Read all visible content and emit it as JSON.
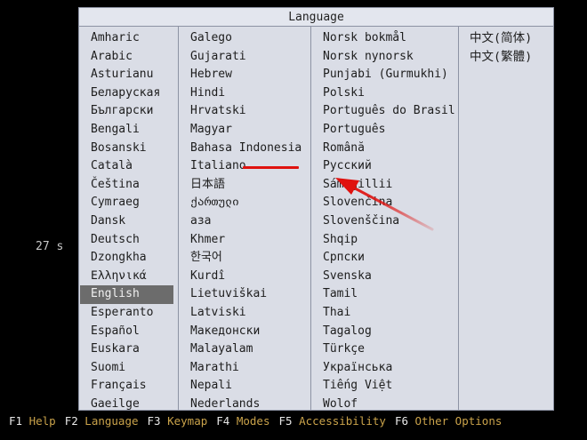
{
  "dialog": {
    "title": "Language",
    "columns": [
      [
        "Amharic",
        "Arabic",
        "Asturianu",
        "Беларуская",
        "Български",
        "Bengali",
        "Bosanski",
        "Català",
        "Čeština",
        "Cymraeg",
        "Dansk",
        "Deutsch",
        "Dzongkha",
        "Ελληνικά",
        "English",
        "Esperanto",
        "Español",
        "Euskara",
        "Suomi",
        "Français",
        "Gaeilge"
      ],
      [
        "Galego",
        "Gujarati",
        "Hebrew",
        "Hindi",
        "Hrvatski",
        "Magyar",
        "Bahasa Indonesia",
        "Italiano",
        "日本語",
        "ქართული",
        "аза",
        "Khmer",
        "한국어",
        "Kurdî",
        "Lietuviškai",
        "Latviski",
        "Македонски",
        "Malayalam",
        "Marathi",
        "Nepali",
        "Nederlands"
      ],
      [
        "Norsk bokmål",
        "Norsk nynorsk",
        "Punjabi (Gurmukhi)",
        "Polski",
        "Português do Brasil",
        "Português",
        "Română",
        "Русский",
        "Sámegillii",
        "Slovenčina",
        "Slovenščina",
        "Shqip",
        "Српски",
        "Svenska",
        "Tamil",
        "Thai",
        "Tagalog",
        "Türkçe",
        "Українська",
        "Tiếng Việt",
        "Wolof"
      ],
      [
        "中文(简体)",
        "中文(繁體)"
      ]
    ],
    "selected": "English"
  },
  "timer": "27 s",
  "function_keys": [
    {
      "key": "F1",
      "label": "Help"
    },
    {
      "key": "F2",
      "label": "Language"
    },
    {
      "key": "F3",
      "label": "Keymap"
    },
    {
      "key": "F4",
      "label": "Modes"
    },
    {
      "key": "F5",
      "label": "Accessibility"
    },
    {
      "key": "F6",
      "label": "Other Options"
    }
  ],
  "colors": {
    "background": "#000000",
    "dialog": "#dadde6",
    "selection": "#6c6c6c",
    "annotation": "#e0120f",
    "fkey_label": "#c9a24a"
  },
  "icons": [
    "annotation-underline",
    "annotation-arrow-icon"
  ]
}
